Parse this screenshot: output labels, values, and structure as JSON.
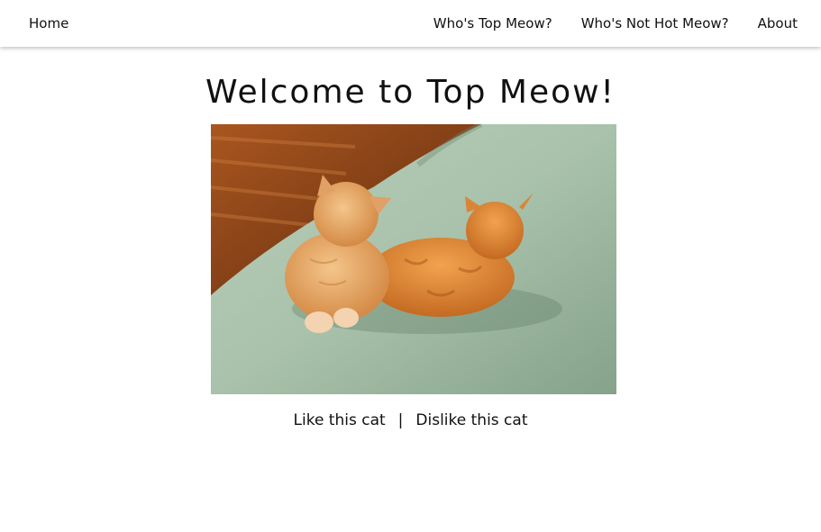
{
  "nav": {
    "home": "Home",
    "top_meow": "Who's Top Meow?",
    "not_hot_meow": "Who's Not Hot Meow?",
    "about": "About"
  },
  "main": {
    "title": "Welcome to Top Meow!",
    "like": "Like this cat",
    "separator": "|",
    "dislike": "Dislike this cat"
  }
}
